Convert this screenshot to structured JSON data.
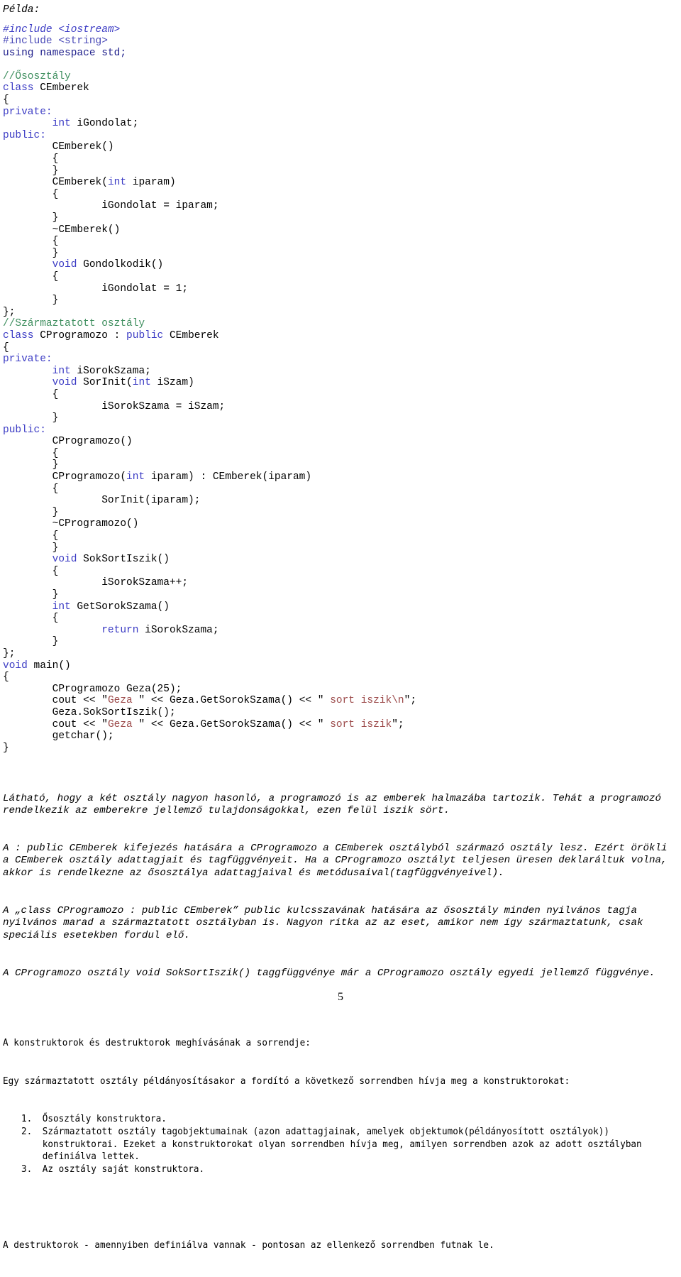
{
  "document": {
    "intro_label": "Példa:",
    "page_number": "5"
  },
  "code": {
    "language": "cpp",
    "lines": [
      [
        {
          "t": "#include <iostream>",
          "c": "prep-italic"
        }
      ],
      [
        {
          "t": "#include <string>",
          "c": "prep"
        }
      ],
      [
        {
          "t": "using namespace std;",
          "c": "navy"
        }
      ],
      [
        {
          "t": "",
          "c": "plain"
        }
      ],
      [
        {
          "t": "//Ősosztály",
          "c": "cmt"
        }
      ],
      [
        {
          "t": "class",
          "c": "kw"
        },
        {
          "t": " CEmberek",
          "c": "plain"
        }
      ],
      [
        {
          "t": "{",
          "c": "plain"
        }
      ],
      [
        {
          "t": "private:",
          "c": "kw"
        }
      ],
      [
        {
          "t": "        ",
          "c": "plain"
        },
        {
          "t": "int",
          "c": "kw"
        },
        {
          "t": " iGondolat;",
          "c": "plain"
        }
      ],
      [
        {
          "t": "public:",
          "c": "kw"
        }
      ],
      [
        {
          "t": "        CEmberek()",
          "c": "plain"
        }
      ],
      [
        {
          "t": "        {",
          "c": "plain"
        }
      ],
      [
        {
          "t": "        }",
          "c": "plain"
        }
      ],
      [
        {
          "t": "        CEmberek(",
          "c": "plain"
        },
        {
          "t": "int",
          "c": "kw"
        },
        {
          "t": " iparam)",
          "c": "plain"
        }
      ],
      [
        {
          "t": "        {",
          "c": "plain"
        }
      ],
      [
        {
          "t": "                iGondolat = iparam;",
          "c": "plain"
        }
      ],
      [
        {
          "t": "        }",
          "c": "plain"
        }
      ],
      [
        {
          "t": "        ~CEmberek()",
          "c": "plain"
        }
      ],
      [
        {
          "t": "        {",
          "c": "plain"
        }
      ],
      [
        {
          "t": "        }",
          "c": "plain"
        }
      ],
      [
        {
          "t": "        ",
          "c": "plain"
        },
        {
          "t": "void",
          "c": "kw"
        },
        {
          "t": " Gondolkodik()",
          "c": "plain"
        }
      ],
      [
        {
          "t": "        {",
          "c": "plain"
        }
      ],
      [
        {
          "t": "                iGondolat = 1;",
          "c": "plain"
        }
      ],
      [
        {
          "t": "        }",
          "c": "plain"
        }
      ],
      [
        {
          "t": "};",
          "c": "plain"
        }
      ],
      [
        {
          "t": "//Származtatott osztály",
          "c": "cmt"
        }
      ],
      [
        {
          "t": "class",
          "c": "kw"
        },
        {
          "t": " CProgramozo : ",
          "c": "plain"
        },
        {
          "t": "public",
          "c": "kw"
        },
        {
          "t": " CEmberek",
          "c": "plain"
        }
      ],
      [
        {
          "t": "{",
          "c": "plain"
        }
      ],
      [
        {
          "t": "private:",
          "c": "kw"
        }
      ],
      [
        {
          "t": "        ",
          "c": "plain"
        },
        {
          "t": "int",
          "c": "kw"
        },
        {
          "t": " iSorokSzama;",
          "c": "plain"
        }
      ],
      [
        {
          "t": "        ",
          "c": "plain"
        },
        {
          "t": "void",
          "c": "kw"
        },
        {
          "t": " SorInit(",
          "c": "plain"
        },
        {
          "t": "int",
          "c": "kw"
        },
        {
          "t": " iSzam)",
          "c": "plain"
        }
      ],
      [
        {
          "t": "        {",
          "c": "plain"
        }
      ],
      [
        {
          "t": "                iSorokSzama = iSzam;",
          "c": "plain"
        }
      ],
      [
        {
          "t": "        }",
          "c": "plain"
        }
      ],
      [
        {
          "t": "public:",
          "c": "kw"
        }
      ],
      [
        {
          "t": "        CProgramozo()",
          "c": "plain"
        }
      ],
      [
        {
          "t": "        {",
          "c": "plain"
        }
      ],
      [
        {
          "t": "        }",
          "c": "plain"
        }
      ],
      [
        {
          "t": "        CProgramozo(",
          "c": "plain"
        },
        {
          "t": "int",
          "c": "kw"
        },
        {
          "t": " iparam) : CEmberek(iparam)",
          "c": "plain"
        }
      ],
      [
        {
          "t": "        {",
          "c": "plain"
        }
      ],
      [
        {
          "t": "                SorInit(iparam);",
          "c": "plain"
        }
      ],
      [
        {
          "t": "        }",
          "c": "plain"
        }
      ],
      [
        {
          "t": "        ~CProgramozo()",
          "c": "plain"
        }
      ],
      [
        {
          "t": "        {",
          "c": "plain"
        }
      ],
      [
        {
          "t": "        }",
          "c": "plain"
        }
      ],
      [
        {
          "t": "        ",
          "c": "plain"
        },
        {
          "t": "void",
          "c": "kw"
        },
        {
          "t": " SokSortIszik()",
          "c": "plain"
        }
      ],
      [
        {
          "t": "        {",
          "c": "plain"
        }
      ],
      [
        {
          "t": "                iSorokSzama++;",
          "c": "plain"
        }
      ],
      [
        {
          "t": "        }",
          "c": "plain"
        }
      ],
      [
        {
          "t": "        ",
          "c": "plain"
        },
        {
          "t": "int",
          "c": "kw"
        },
        {
          "t": " GetSorokSzama()",
          "c": "plain"
        }
      ],
      [
        {
          "t": "        {",
          "c": "plain"
        }
      ],
      [
        {
          "t": "                ",
          "c": "plain"
        },
        {
          "t": "return",
          "c": "kw"
        },
        {
          "t": " iSorokSzama;",
          "c": "plain"
        }
      ],
      [
        {
          "t": "        }",
          "c": "plain"
        }
      ],
      [
        {
          "t": "};",
          "c": "plain"
        }
      ],
      [
        {
          "t": "void",
          "c": "kw"
        },
        {
          "t": " main()",
          "c": "plain"
        }
      ],
      [
        {
          "t": "{",
          "c": "plain"
        }
      ],
      [
        {
          "t": "        CProgramozo Geza(25);",
          "c": "plain"
        }
      ],
      [
        {
          "t": "        cout << \"",
          "c": "plain"
        },
        {
          "t": "Geza ",
          "c": "str"
        },
        {
          "t": "\" << Geza.GetSorokSzama() << \"",
          "c": "plain"
        },
        {
          "t": " sort iszik\\n",
          "c": "str"
        },
        {
          "t": "\";",
          "c": "plain"
        }
      ],
      [
        {
          "t": "        Geza.SokSortIszik();",
          "c": "plain"
        }
      ],
      [
        {
          "t": "        cout << \"",
          "c": "plain"
        },
        {
          "t": "Geza ",
          "c": "str"
        },
        {
          "t": "\" << Geza.GetSorokSzama() << \"",
          "c": "plain"
        },
        {
          "t": " sort iszik",
          "c": "str"
        },
        {
          "t": "\";",
          "c": "plain"
        }
      ],
      [
        {
          "t": "        getchar();",
          "c": "plain"
        }
      ],
      [
        {
          "t": "}",
          "c": "plain"
        }
      ]
    ]
  },
  "prose": {
    "paragraph_1": "Látható, hogy a két osztály nagyon hasonló, a programozó is az emberek halmazába tartozik. Tehát a programozó rendelkezik az emberekre jellemző tulajdonságokkal, ezen felül iszik sört.",
    "paragraph_2": "A : public CEmberek kifejezés hatására a CProgramozo a CEmberek osztályból származó osztály lesz. Ezért örökli a CEmberek osztály adattagjait és tagfüggvényeit. Ha a CProgramozo osztályt teljesen üresen deklaráltuk volna, akkor is rendelkezne az ősosztálya adattagjaival és metódusaival(tagfüggvényeivel).",
    "paragraph_3": "A „class CProgramozo : public CEmberek” public kulcsszavának hatására az ősosztály minden nyilvános tagja nyilvános marad a származtatott osztályban is. Nagyon ritka az az eset, amikor nem így származtatunk, csak speciális esetekben fordul elő.",
    "paragraph_4": "A CProgramozo osztály void SokSortIszik() taggfüggvénye már a CProgramozo osztály egyedi jellemző függvénye."
  },
  "ordering_section": {
    "heading": "A konstruktorok és destruktorok meghívásának a sorrendje:",
    "lead": "Egy származtatott osztály példányosításakor a fordító a következő sorrendben hívja meg a konstruktorokat:",
    "items": [
      {
        "num": "1.",
        "text": "Ősosztály konstruktora."
      },
      {
        "num": "2.",
        "text": "Származtatott osztály tagobjektumainak (azon adattagjainak, amelyek objektumok(példányosított osztályok)) konstruktorai. Ezeket a konstruktorokat olyan sorrendben hívja meg, amilyen sorrendben azok az adott osztályban definiálva lettek."
      },
      {
        "num": "3.",
        "text": "Az osztály saját konstruktora."
      }
    ],
    "closing": "A destruktorok - amennyiben definiálva vannak - pontosan az ellenkező sorrendben futnak le."
  },
  "colors": {
    "keyword": "#3b3bc4",
    "comment": "#3f8f5f",
    "string": "#9c4a4a",
    "navy": "#20208c",
    "text": "#000000",
    "background": "#ffffff"
  }
}
